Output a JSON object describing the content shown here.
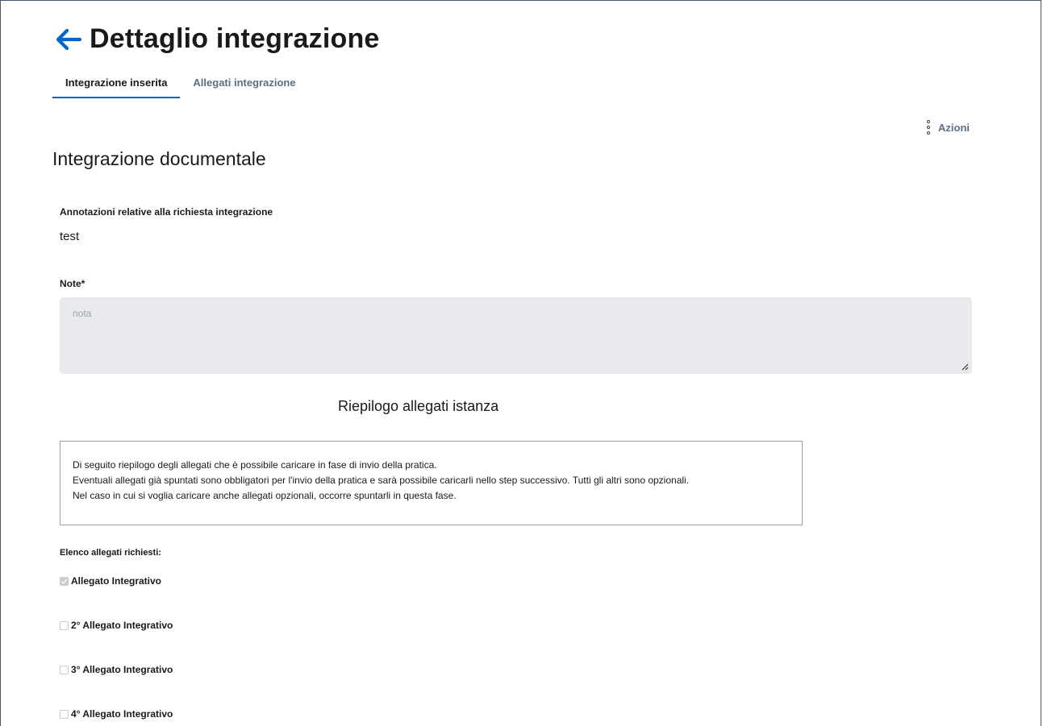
{
  "header": {
    "title": "Dettaglio integrazione",
    "back_icon": "arrow-left-icon",
    "accent_color": "#0066cc"
  },
  "tabs": [
    {
      "label": "Integrazione inserita",
      "active": true
    },
    {
      "label": "Allegati integrazione",
      "active": false
    }
  ],
  "actions": {
    "label": "Azioni",
    "icon": "more-vertical-icon"
  },
  "section": {
    "title": "Integrazione documentale"
  },
  "annotations": {
    "label": "Annotazioni relative alla richiesta integrazione",
    "value": "test"
  },
  "note": {
    "label": "Note*",
    "placeholder": "nota",
    "value": ""
  },
  "summary": {
    "title": "Riepilogo allegati istanza",
    "info_lines": [
      "Di seguito riepilogo degli allegati che è possibile caricare in fase di invio della pratica.",
      "Eventuali allegati già spuntati sono obbligatori per l'invio della pratica e sarà possibile caricarli nello step successivo. Tutti gli altri sono opzionali.",
      "Nel caso in cui si voglia caricare anche allegati opzionali, occorre spuntarli in questa fase."
    ]
  },
  "attachments": {
    "label": "Elenco allegati richiesti:",
    "items": [
      {
        "label": "Allegato Integrativo",
        "checked": true,
        "disabled": true
      },
      {
        "label": "2° Allegato Integrativo",
        "checked": false,
        "disabled": false
      },
      {
        "label": "3° Allegato Integrativo",
        "checked": false,
        "disabled": false
      },
      {
        "label": "4° Allegato Integrativo",
        "checked": false,
        "disabled": false
      }
    ]
  }
}
